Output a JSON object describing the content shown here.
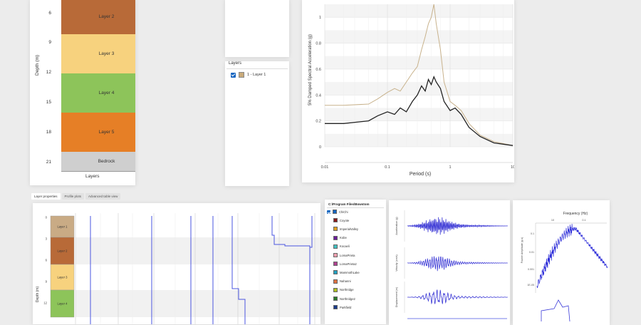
{
  "profile": {
    "ylabel": "Depth (m)",
    "xlabel": "Layers",
    "ticks": [
      "6",
      "9",
      "12",
      "15",
      "18",
      "21"
    ],
    "layers": [
      {
        "label": "Layer 2",
        "color": "#b86a38"
      },
      {
        "label": "Layer 3",
        "color": "#f7d27e"
      },
      {
        "label": "Layer 4",
        "color": "#8dc45a"
      },
      {
        "label": "Layer 5",
        "color": "#e67f26"
      },
      {
        "label": "Bedrock",
        "color": "#cfcfcf"
      }
    ]
  },
  "layers_panel": {
    "title": "Layers",
    "item_label": "1 - Layer 1",
    "item_color": "#b89a6a"
  },
  "chart_data": {
    "type": "line",
    "ylabel": "5% Damped Spectral Acceleration (g)",
    "xlabel": "Period (s)",
    "x_scale": "log",
    "xlim": [
      0.01,
      10
    ],
    "ylim": [
      0,
      1.1
    ],
    "x_ticks": [
      "0.01",
      "0.1",
      "1",
      "10"
    ],
    "y_ticks": [
      "0",
      "0.2",
      "0.4",
      "0.6",
      "0.8",
      "1"
    ],
    "grid": true,
    "series": [
      {
        "color": "#c8b28c",
        "x": [
          0.01,
          0.02,
          0.05,
          0.07,
          0.1,
          0.13,
          0.16,
          0.2,
          0.25,
          0.3,
          0.35,
          0.4,
          0.45,
          0.5,
          0.55,
          0.6,
          0.7,
          0.8,
          1.0,
          1.2,
          1.5,
          2,
          3,
          5,
          10
        ],
        "y": [
          0.32,
          0.32,
          0.33,
          0.37,
          0.42,
          0.45,
          0.43,
          0.5,
          0.57,
          0.62,
          0.75,
          0.85,
          0.95,
          1.0,
          1.1,
          0.95,
          0.75,
          0.5,
          0.35,
          0.32,
          0.28,
          0.18,
          0.09,
          0.04,
          0.01
        ]
      },
      {
        "color": "#222222",
        "x": [
          0.01,
          0.02,
          0.05,
          0.07,
          0.1,
          0.13,
          0.16,
          0.2,
          0.25,
          0.3,
          0.35,
          0.4,
          0.45,
          0.5,
          0.55,
          0.6,
          0.7,
          0.8,
          1.0,
          1.2,
          1.5,
          2,
          3,
          5,
          10
        ],
        "y": [
          0.18,
          0.18,
          0.2,
          0.24,
          0.27,
          0.25,
          0.3,
          0.27,
          0.35,
          0.4,
          0.47,
          0.43,
          0.52,
          0.48,
          0.54,
          0.5,
          0.45,
          0.35,
          0.28,
          0.3,
          0.25,
          0.15,
          0.08,
          0.03,
          0.01
        ]
      }
    ]
  },
  "tabs": [
    "Layer properties",
    "Profile plots",
    "Advanced table view"
  ],
  "bottom_profile": {
    "ylabel": "Depth (m)",
    "ticks": [
      "0",
      "3",
      "6",
      "9",
      "12"
    ],
    "layers": [
      {
        "label": "Layer 1",
        "color": "#c9ab85"
      },
      {
        "label": "Layer 2",
        "color": "#b86a38"
      },
      {
        "label": "Layer 3",
        "color": "#f7d27e"
      },
      {
        "label": "Layer 4",
        "color": "#8dc45a"
      }
    ]
  },
  "records": {
    "path": "C:\\Program Files\\Bowstom",
    "items": [
      {
        "label": "ChiChi",
        "color": "#1565c0",
        "checked": true
      },
      {
        "label": "Coyote",
        "color": "#8b1a1a"
      },
      {
        "label": "ImperialValley",
        "color": "#e0a020"
      },
      {
        "label": "Kobe",
        "color": "#6a1b9a"
      },
      {
        "label": "Kocaeli",
        "color": "#40c0c0"
      },
      {
        "label": "LomaPrieta",
        "color": "#f4a0b0"
      },
      {
        "label": "LomaPrieta2",
        "color": "#b04090"
      },
      {
        "label": "MammothLake",
        "color": "#20a0c0"
      },
      {
        "label": "Nahanni",
        "color": "#e07040"
      },
      {
        "label": "Northridge",
        "color": "#b0c020"
      },
      {
        "label": "Northridge2",
        "color": "#2a7a2a"
      },
      {
        "label": "Parkfield",
        "color": "#1a3a8a"
      }
    ]
  },
  "time_histories": {
    "labels": [
      "Acceleration (g)",
      "Velocity (cm/s)",
      "Displacement (m)"
    ]
  },
  "frequency": {
    "title": "Frequency (Hz)",
    "top_ticks": [
      "10",
      "0.1"
    ],
    "ylabel": "Fourier Amplitude (g-s)",
    "y_ticks": [
      "0.1",
      "0.01",
      "0.001",
      "1E-05"
    ]
  }
}
